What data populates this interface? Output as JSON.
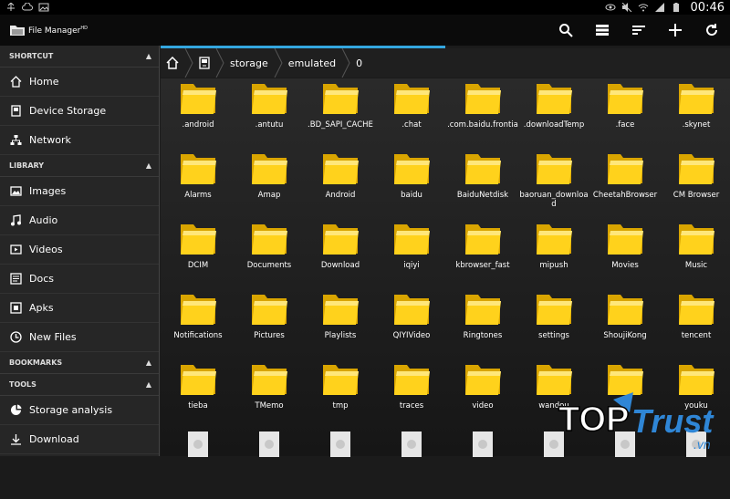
{
  "status": {
    "time": "00:46"
  },
  "app": {
    "title": "File Manager",
    "title_sup": "HD"
  },
  "actions": [
    {
      "name": "search-icon"
    },
    {
      "name": "view-toggle-icon"
    },
    {
      "name": "sort-icon"
    },
    {
      "name": "add-icon"
    },
    {
      "name": "refresh-icon"
    }
  ],
  "sidebar": {
    "sections": [
      {
        "title": "SHORTCUT",
        "items": [
          {
            "label": "Home",
            "icon": "home-icon"
          },
          {
            "label": "Device Storage",
            "icon": "device-storage-icon"
          },
          {
            "label": "Network",
            "icon": "network-icon"
          }
        ]
      },
      {
        "title": "LIBRARY",
        "items": [
          {
            "label": "Images",
            "icon": "images-icon"
          },
          {
            "label": "Audio",
            "icon": "audio-icon"
          },
          {
            "label": "Videos",
            "icon": "videos-icon"
          },
          {
            "label": "Docs",
            "icon": "docs-icon"
          },
          {
            "label": "Apks",
            "icon": "apks-icon"
          },
          {
            "label": "New Files",
            "icon": "new-files-icon"
          }
        ]
      },
      {
        "title": "BOOKMARKS",
        "items": []
      },
      {
        "title": "TOOLS",
        "items": [
          {
            "label": "Storage analysis",
            "icon": "storage-analysis-icon"
          },
          {
            "label": "Download",
            "icon": "download-icon"
          }
        ]
      }
    ]
  },
  "breadcrumb": [
    "storage",
    "emulated",
    "0"
  ],
  "folders": [
    ".android",
    ".antutu",
    ".BD_SAPI_CACHE",
    ".chat",
    ".com.baidu.frontia",
    ".downloadTemp",
    ".face",
    ".skynet",
    "Alarms",
    "Amap",
    "Android",
    "baidu",
    "BaiduNetdisk",
    "baoruan_download",
    "CheetahBrowser",
    "CM Browser",
    "DCIM",
    "Documents",
    "Download",
    "iqiyi",
    "kbrowser_fast",
    "mipush",
    "Movies",
    "Music",
    "Notifications",
    "Pictures",
    "Playlists",
    "QIYIVideo",
    "Ringtones",
    "settings",
    "ShoujiKong",
    "tencent",
    "tieba",
    "TMemo",
    "tmp",
    "traces",
    "video",
    "wandou",
    "",
    "youku"
  ],
  "watermark": {
    "text1": "TOP",
    "text2": "Trust",
    "text3": ".vn"
  },
  "colors": {
    "accent": "#34a7e0",
    "folder": "#ffd21c",
    "watermark_blue": "#2f86d6"
  }
}
